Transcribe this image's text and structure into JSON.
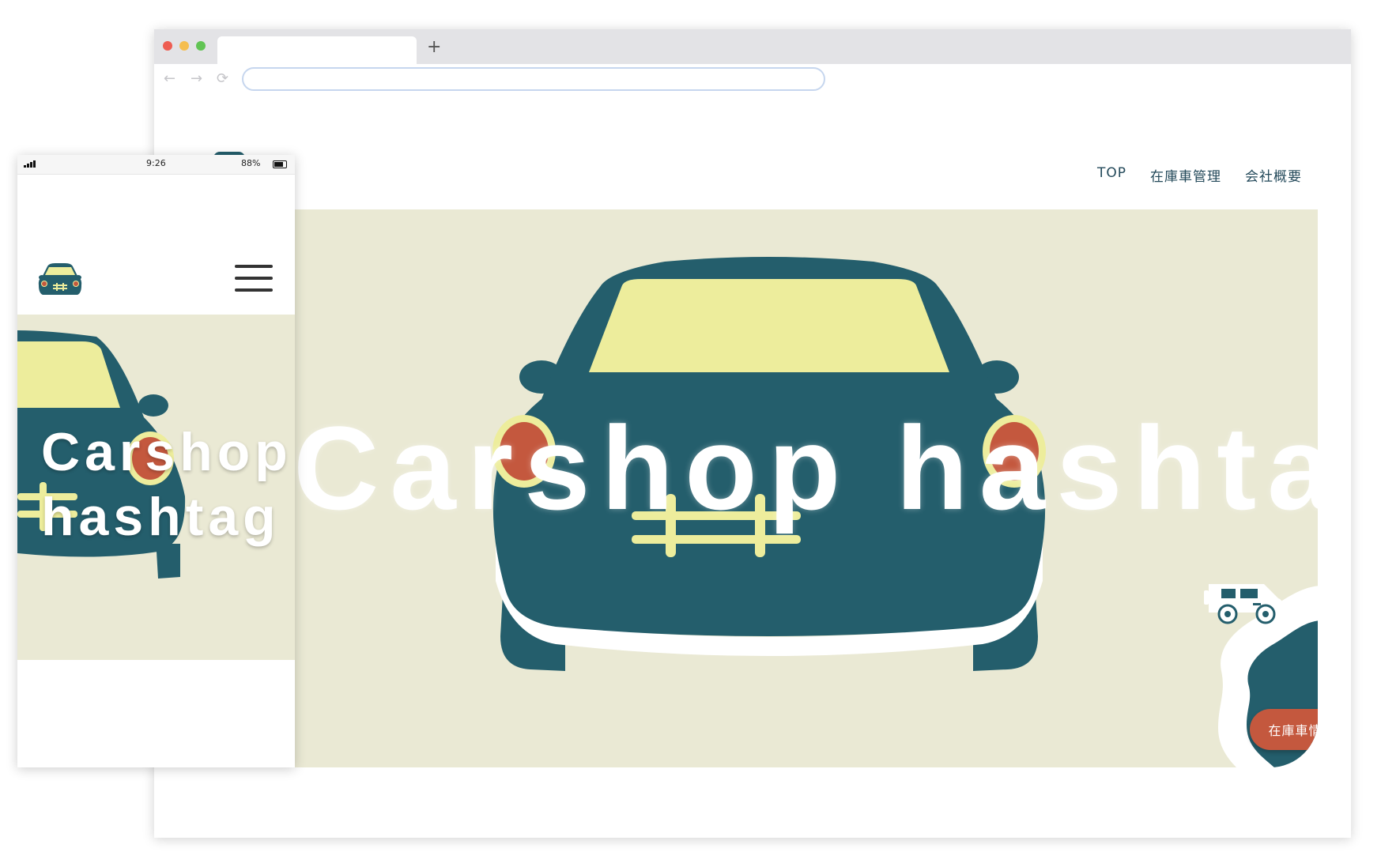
{
  "browser": {
    "window_controls": [
      "close",
      "minimize",
      "maximize"
    ],
    "new_tab_label": "+",
    "nav_icons": [
      "back-icon",
      "forward-icon",
      "reload-icon"
    ],
    "url_value": ""
  },
  "site": {
    "nav": [
      {
        "label": "TOP"
      },
      {
        "label": "在庫車管理"
      },
      {
        "label": "会社概要"
      }
    ],
    "hero_title": "Carshop hashtag",
    "cta_label": "在庫車情報へ",
    "cta_arrow": "→"
  },
  "mobile": {
    "status": {
      "time": "9:26",
      "battery": "88%"
    },
    "hero_title_line1": "Carshop",
    "hero_title_line2": "hashtag"
  },
  "colors": {
    "car_body": "#245e6c",
    "windshield": "#eded9c",
    "headlight": "#c4583e",
    "hero_bg": "#eae9d4",
    "nav_text": "#23495a",
    "cta_bg": "#c4583e"
  }
}
